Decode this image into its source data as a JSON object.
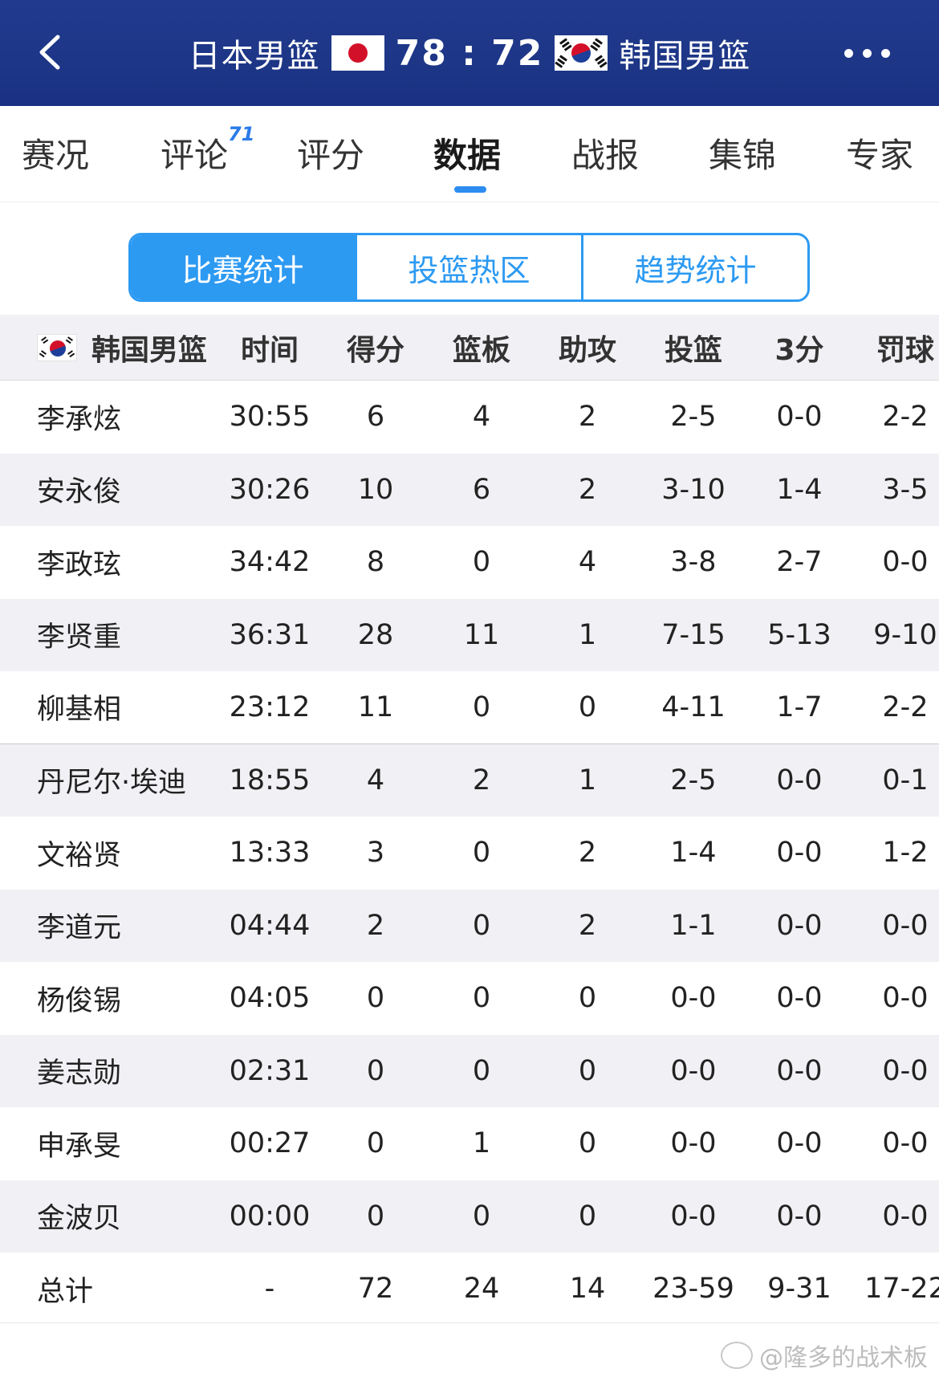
{
  "header": {
    "home_team": "日本男篮",
    "score": "78 : 72",
    "away_team": "韩国男篮"
  },
  "tabs": [
    {
      "label": "赛况"
    },
    {
      "label": "评论",
      "badge": "71"
    },
    {
      "label": "评分"
    },
    {
      "label": "数据",
      "active": true
    },
    {
      "label": "战报"
    },
    {
      "label": "集锦"
    },
    {
      "label": "专家"
    }
  ],
  "segments": [
    {
      "label": "比赛统计",
      "active": true
    },
    {
      "label": "投篮热区"
    },
    {
      "label": "趋势统计"
    }
  ],
  "table": {
    "team": "韩国男篮",
    "columns": [
      "时间",
      "得分",
      "篮板",
      "助攻",
      "投篮",
      "3分",
      "罚球"
    ],
    "rows": [
      {
        "name": "李承炫",
        "time": "30:55",
        "pts": "6",
        "reb": "4",
        "ast": "2",
        "fg": "2-5",
        "tp": "0-0",
        "ft": "2-2"
      },
      {
        "name": "安永俊",
        "time": "30:26",
        "pts": "10",
        "reb": "6",
        "ast": "2",
        "fg": "3-10",
        "tp": "1-4",
        "ft": "3-5"
      },
      {
        "name": "李政玹",
        "time": "34:42",
        "pts": "8",
        "reb": "0",
        "ast": "4",
        "fg": "3-8",
        "tp": "2-7",
        "ft": "0-0"
      },
      {
        "name": "李贤重",
        "time": "36:31",
        "pts": "28",
        "reb": "11",
        "ast": "1",
        "fg": "7-15",
        "tp": "5-13",
        "ft": "9-10"
      },
      {
        "name": "柳基相",
        "time": "23:12",
        "pts": "11",
        "reb": "0",
        "ast": "0",
        "fg": "4-11",
        "tp": "1-7",
        "ft": "2-2"
      },
      {
        "name": "丹尼尔·埃迪",
        "time": "18:55",
        "pts": "4",
        "reb": "2",
        "ast": "1",
        "fg": "2-5",
        "tp": "0-0",
        "ft": "0-1"
      },
      {
        "name": "文裕贤",
        "time": "13:33",
        "pts": "3",
        "reb": "0",
        "ast": "2",
        "fg": "1-4",
        "tp": "0-0",
        "ft": "1-2"
      },
      {
        "name": "李道元",
        "time": "04:44",
        "pts": "2",
        "reb": "0",
        "ast": "2",
        "fg": "1-1",
        "tp": "0-0",
        "ft": "0-0"
      },
      {
        "name": "杨俊锡",
        "time": "04:05",
        "pts": "0",
        "reb": "0",
        "ast": "0",
        "fg": "0-0",
        "tp": "0-0",
        "ft": "0-0"
      },
      {
        "name": "姜志勋",
        "time": "02:31",
        "pts": "0",
        "reb": "0",
        "ast": "0",
        "fg": "0-0",
        "tp": "0-0",
        "ft": "0-0"
      },
      {
        "name": "申承旻",
        "time": "00:27",
        "pts": "0",
        "reb": "1",
        "ast": "0",
        "fg": "0-0",
        "tp": "0-0",
        "ft": "0-0"
      },
      {
        "name": "金波贝",
        "time": "00:00",
        "pts": "0",
        "reb": "0",
        "ast": "0",
        "fg": "0-0",
        "tp": "0-0",
        "ft": "0-0"
      }
    ],
    "total": {
      "name": "总计",
      "time": "-",
      "pts": "72",
      "reb": "24",
      "ast": "14",
      "fg": "23-59",
      "tp": "9-31",
      "ft": "17-22"
    }
  },
  "watermark": "@隆多的战术板",
  "colors": {
    "header_bg": "#1d3686",
    "accent": "#2d9af2",
    "row_alt": "#f1f1f5"
  }
}
